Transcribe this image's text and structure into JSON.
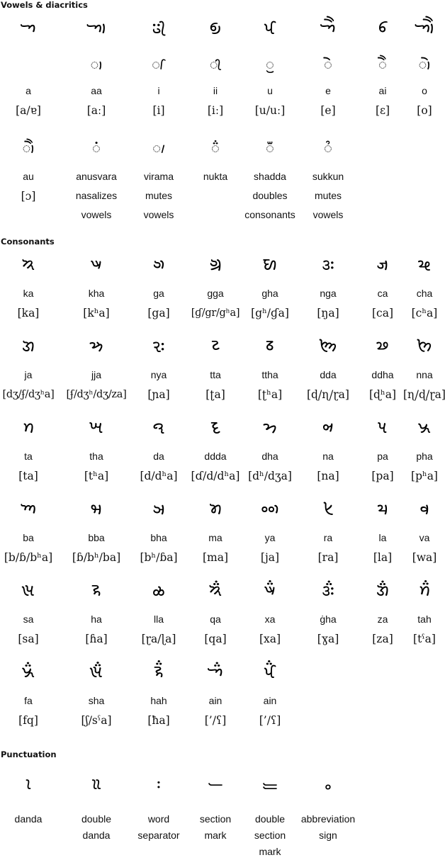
{
  "sections": {
    "vowels": {
      "title": "Vowels & diacritics",
      "row1": [
        {
          "letter": "𑈀",
          "sign": "",
          "name": "a",
          "ipa": "[a/ɐ]"
        },
        {
          "letter": "𑈁",
          "sign": "◌𑈬",
          "name": "aa",
          "ipa": "[aː]"
        },
        {
          "letter": "𑈂",
          "sign": "◌𑈭",
          "name": "i",
          "ipa": "[i]"
        },
        {
          "letter": "𑈃",
          "sign": "◌𑈮",
          "name": "ii",
          "ipa": "[iː]"
        },
        {
          "letter": "𑈄",
          "sign": "◌𑈯",
          "name": "u",
          "ipa": "[u/uː]"
        },
        {
          "letter": "𑈅",
          "sign": "◌𑈰",
          "name": "e",
          "ipa": "[e]"
        },
        {
          "letter": "𑈆",
          "sign": "◌𑈱",
          "name": "ai",
          "ipa": "[ɛ]"
        },
        {
          "letter": "𑈇",
          "sign": "◌𑈲",
          "name": "o",
          "ipa": "[o]"
        }
      ],
      "row2": [
        {
          "sign": "◌𑈳",
          "lines": [
            "au",
            "[ɔ]"
          ],
          "ipa_line": 1
        },
        {
          "sign": "◌𑈴",
          "lines": [
            "anusvara",
            "nasalizes",
            "vowels"
          ]
        },
        {
          "sign": "◌𑈵",
          "lines": [
            "virama",
            "mutes",
            "vowels"
          ]
        },
        {
          "sign": "◌𑈶",
          "lines": [
            "nukta"
          ]
        },
        {
          "sign": "◌𑈷",
          "lines": [
            "shadda",
            "doubles",
            "consonants"
          ]
        },
        {
          "sign": "◌𑈾",
          "lines": [
            "sukkun",
            "mutes",
            "vowels"
          ]
        }
      ]
    },
    "consonants": {
      "title": "Consonants",
      "rows": [
        [
          {
            "letter": "𑈈",
            "name": "ka",
            "ipa": "[ka]"
          },
          {
            "letter": "𑈉",
            "name": "kha",
            "ipa": "[kʰa]"
          },
          {
            "letter": "𑈊",
            "name": "ga",
            "ipa": "[ga]"
          },
          {
            "letter": "𑈋",
            "name": "gga",
            "ipa": "[ɠ/gr/gʰa]"
          },
          {
            "letter": "𑈌",
            "name": "gha",
            "ipa": "[gʰ/ɠa]"
          },
          {
            "letter": "𑈍",
            "name": "nga",
            "ipa": "[ŋa]"
          },
          {
            "letter": "𑈎",
            "name": "ca",
            "ipa": "[ca]"
          },
          {
            "letter": "𑈏",
            "name": "cha",
            "ipa": "[cʰa]"
          }
        ],
        [
          {
            "letter": "𑈐",
            "name": "ja",
            "ipa": "[dʒ/ʄ/dʒʰa]"
          },
          {
            "letter": "𑈑",
            "name": "jja",
            "ipa": "[ʄ/dʒʰ/dʒ/za]"
          },
          {
            "letter": "𑈓",
            "name": "nya",
            "ipa": "[ɲa]"
          },
          {
            "letter": "𑈔",
            "name": "tta",
            "ipa": "[ʈa]"
          },
          {
            "letter": "𑈕",
            "name": "ttha",
            "ipa": "[ʈʰa]"
          },
          {
            "letter": "𑈖",
            "name": "dda",
            "ipa": "[ɖ/ɳ/ɽa]"
          },
          {
            "letter": "𑈗",
            "name": "ddha",
            "ipa": "[ɖʰa]"
          },
          {
            "letter": "𑈘",
            "name": "nna",
            "ipa": "[ɳ/ɖ/ɽa]"
          }
        ],
        [
          {
            "letter": "𑈙",
            "name": "ta",
            "ipa": "[ta]"
          },
          {
            "letter": "𑈚",
            "name": "tha",
            "ipa": "[tʰa]"
          },
          {
            "letter": "𑈛",
            "name": "da",
            "ipa": "[d/dʰa]"
          },
          {
            "letter": "𑈜",
            "name": "ddda",
            "ipa": "[ɗ/d/dʰa]"
          },
          {
            "letter": "𑈝",
            "name": "dha",
            "ipa": "[dʰ/dʒa]"
          },
          {
            "letter": "𑈞",
            "name": "na",
            "ipa": "[na]"
          },
          {
            "letter": "𑈟",
            "name": "pa",
            "ipa": "[pa]"
          },
          {
            "letter": "𑈠",
            "name": "pha",
            "ipa": "[pʰa]"
          }
        ],
        [
          {
            "letter": "𑈡",
            "name": "ba",
            "ipa": "[b/ɓ/bʰa]"
          },
          {
            "letter": "𑈢",
            "name": "bba",
            "ipa": "[ɓ/bʰ/ba]"
          },
          {
            "letter": "𑈣",
            "name": "bha",
            "ipa": "[bʰ/ɓa]"
          },
          {
            "letter": "𑈤",
            "name": "ma",
            "ipa": "[ma]"
          },
          {
            "letter": "𑈥",
            "name": "ya",
            "ipa": "[ja]"
          },
          {
            "letter": "𑈦",
            "name": "ra",
            "ipa": "[ra]"
          },
          {
            "letter": "𑈧",
            "name": "la",
            "ipa": "[la]"
          },
          {
            "letter": "𑈨",
            "name": "va",
            "ipa": "[wa]"
          }
        ],
        [
          {
            "letter": "𑈩",
            "name": "sa",
            "ipa": "[sa]"
          },
          {
            "letter": "𑈪",
            "name": "ha",
            "ipa": "[ɦa]"
          },
          {
            "letter": "𑈫",
            "name": "lla",
            "ipa": "[ɽa/ɭa]"
          },
          {
            "letter": "𑈈𑈶",
            "name": "qa",
            "ipa": "[qa]"
          },
          {
            "letter": "𑈉𑈶",
            "name": "xa",
            "ipa": "[xa]"
          },
          {
            "letter": "𑈍𑈶",
            "name": "ġha",
            "ipa": "[ɣa]"
          },
          {
            "letter": "𑈐𑈶",
            "name": "za",
            "ipa": "[za]"
          },
          {
            "letter": "𑈙𑈶",
            "name": "tah",
            "ipa": "[tˤa]"
          }
        ],
        [
          {
            "letter": "𑈠𑈶",
            "name": "fa",
            "ipa": "[fq]"
          },
          {
            "letter": "𑈩𑈶",
            "name": "sha",
            "ipa": "[ʃ/sˤa]"
          },
          {
            "letter": "𑈪𑈶",
            "name": "hah",
            "ipa": "[ħa]"
          },
          {
            "letter": "𑈀𑈶",
            "name": "ain",
            "ipa": "[’/ʕ]"
          },
          {
            "letter": "𑈄𑈶",
            "name": "ain",
            "ipa": "[’/ʕ]"
          }
        ]
      ]
    },
    "punctuation": {
      "title": "Punctuation",
      "items": [
        {
          "glyph": "𑈸",
          "lines": [
            "danda"
          ]
        },
        {
          "glyph": "𑈹",
          "lines": [
            "double",
            "danda"
          ]
        },
        {
          "glyph": "𑈺",
          "lines": [
            "word",
            "separator"
          ]
        },
        {
          "glyph": "𑈻",
          "lines": [
            "section",
            "mark"
          ]
        },
        {
          "glyph": "𑈼",
          "lines": [
            "double",
            "section",
            "mark"
          ]
        },
        {
          "glyph": "𑈽",
          "lines": [
            "abbreviation",
            "sign"
          ]
        }
      ]
    }
  }
}
